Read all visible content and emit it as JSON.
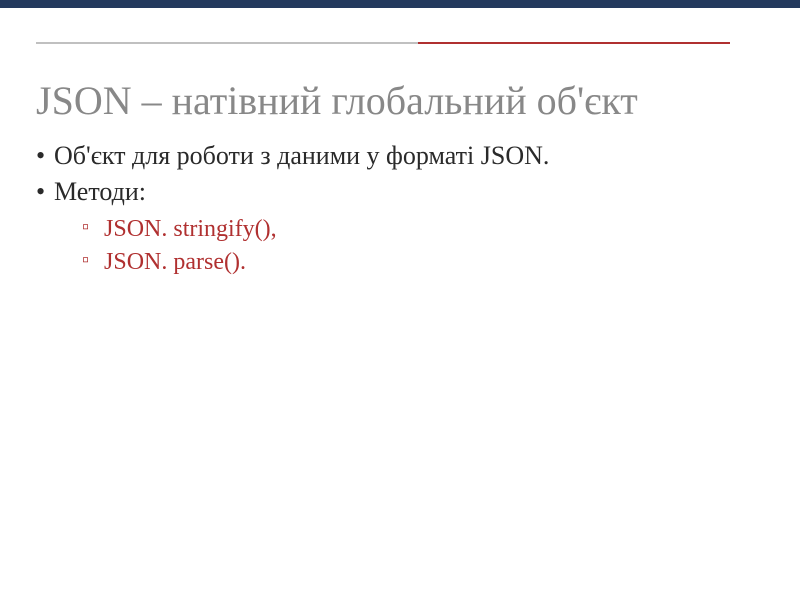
{
  "slide": {
    "title": "JSON – натівний глобальний об'єкт",
    "bullets": [
      {
        "text": "Об'єкт для роботи з даними у форматі JSON."
      },
      {
        "text": "Методи:",
        "subitems": [
          "JSON. stringify(),",
          "JSON. parse()."
        ]
      }
    ]
  },
  "colors": {
    "topBorder": "#243a5e",
    "dividerGray": "#c0c0c0",
    "dividerRed": "#b03030",
    "titleGray": "#888888",
    "textDark": "#2a2a2a",
    "subRed": "#b03030"
  }
}
